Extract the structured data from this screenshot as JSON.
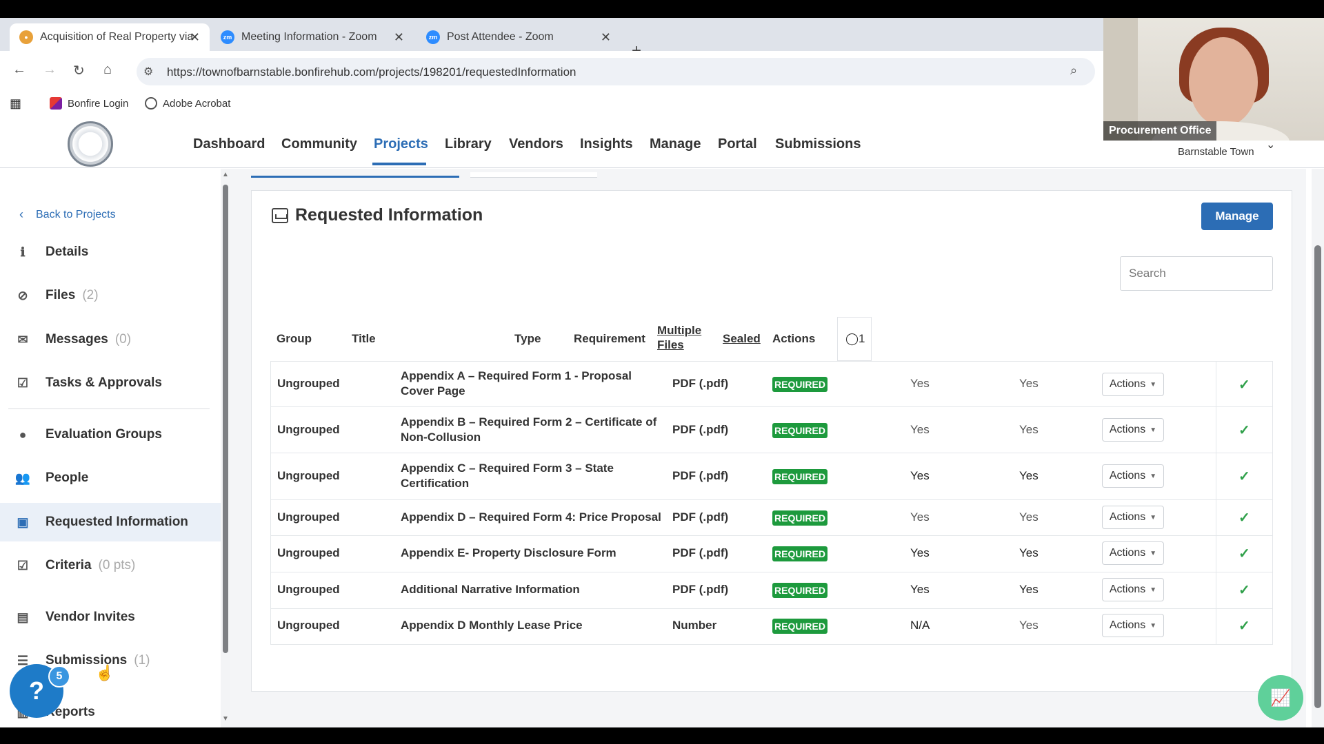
{
  "browser": {
    "tabs": [
      {
        "label": "Acquisition of Real Property via",
        "icon": "bonfire-icon",
        "color": "#e8a13a"
      },
      {
        "label": "Meeting Information - Zoom",
        "icon": "zoom-icon",
        "color": "#2d8cff"
      },
      {
        "label": "Post Attendee - Zoom",
        "icon": "zoom-icon",
        "color": "#2d8cff"
      }
    ],
    "close_glyph": "✕",
    "new_tab_glyph": "+",
    "url": "https://townofbarnstable.bonfirehub.com/projects/198201/requestedInformation",
    "bookmarks": [
      {
        "label": "Bonfire Login",
        "icon": "bonfire-icon"
      },
      {
        "label": "Adobe Acrobat",
        "icon": "globe-icon"
      }
    ]
  },
  "video": {
    "label": "Procurement Office"
  },
  "app": {
    "nav": [
      "Dashboard",
      "Community",
      "Projects",
      "Library",
      "Vendors",
      "Insights",
      "Manage",
      "Portal",
      "Submissions"
    ],
    "active_nav": "Projects",
    "account": "Barnstable Town"
  },
  "sidebar": {
    "back": "Back to Projects",
    "items": [
      {
        "label": "Details",
        "count": "",
        "icon": "info-icon"
      },
      {
        "label": "Files",
        "count": "(2)",
        "icon": "paperclip-icon"
      },
      {
        "label": "Messages",
        "count": "(0)",
        "icon": "envelope-icon"
      },
      {
        "label": "Tasks & Approvals",
        "count": "",
        "icon": "checkbox-icon"
      },
      {
        "label": "Evaluation Groups",
        "count": "",
        "icon": "circle-icon"
      },
      {
        "label": "People",
        "count": "",
        "icon": "people-icon"
      },
      {
        "label": "Requested Information",
        "count": "",
        "icon": "inbox-icon"
      },
      {
        "label": "Criteria",
        "count": "(0 pts)",
        "icon": "checkbox-icon"
      },
      {
        "label": "Vendor Invites",
        "count": "",
        "icon": "contact-icon"
      },
      {
        "label": "Submissions",
        "count": "(1)",
        "icon": "list-icon"
      },
      {
        "label": "Reports",
        "count": "",
        "icon": "chart-icon"
      }
    ],
    "active": "Requested Information",
    "help_badge": "5",
    "help_glyph": "?"
  },
  "main": {
    "title": "Requested Information",
    "manage_label": "Manage",
    "search_placeholder": "Search",
    "columns": [
      "Group",
      "Title",
      "Type",
      "Requirement",
      "Multiple Files",
      "Sealed",
      "Actions"
    ],
    "col_counter": "1",
    "rows": [
      {
        "group": "Ungrouped",
        "title": "Appendix A – Required Form 1 - Proposal Cover Page",
        "type": "PDF (.pdf)",
        "requirement": "REQUIRED",
        "multiple": "Yes",
        "sealed": "Yes",
        "action": "Actions"
      },
      {
        "group": "Ungrouped",
        "title": "Appendix B – Required Form 2 – Certificate of Non-Collusion",
        "type": "PDF (.pdf)",
        "requirement": "REQUIRED",
        "multiple": "Yes",
        "sealed": "Yes",
        "action": "Actions"
      },
      {
        "group": "Ungrouped",
        "title": "Appendix C – Required Form 3 – State Certification",
        "type": "PDF (.pdf)",
        "requirement": "REQUIRED",
        "multiple": "Yes",
        "sealed": "Yes",
        "action": "Actions"
      },
      {
        "group": "Ungrouped",
        "title": "Appendix D – Required Form 4: Price Proposal",
        "type": "PDF (.pdf)",
        "requirement": "REQUIRED",
        "multiple": "Yes",
        "sealed": "Yes",
        "action": "Actions"
      },
      {
        "group": "Ungrouped",
        "title": "Appendix E- Property Disclosure Form",
        "type": "PDF (.pdf)",
        "requirement": "REQUIRED",
        "multiple": "Yes",
        "sealed": "Yes",
        "action": "Actions"
      },
      {
        "group": "Ungrouped",
        "title": "Additional Narrative Information",
        "type": "PDF (.pdf)",
        "requirement": "REQUIRED",
        "multiple": "Yes",
        "sealed": "Yes",
        "action": "Actions"
      },
      {
        "group": "Ungrouped",
        "title": "Appendix D Monthly Lease Price",
        "type": "Number",
        "requirement": "REQUIRED",
        "multiple": "N/A",
        "sealed": "Yes",
        "action": "Actions"
      }
    ],
    "check_glyph": "✓",
    "accent": "#2c6db5",
    "required_color": "#1d9a3d"
  }
}
